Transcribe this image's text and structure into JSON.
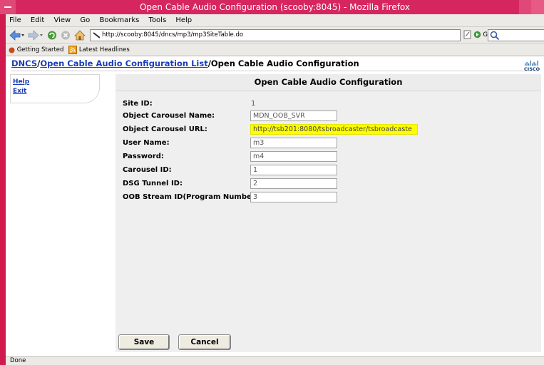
{
  "window": {
    "title": "Open Cable Audio Configuration (scooby:8045) - Mozilla Firefox"
  },
  "menu": {
    "items": [
      "File",
      "Edit",
      "View",
      "Go",
      "Bookmarks",
      "Tools",
      "Help"
    ]
  },
  "toolbar": {
    "url": "http://scooby:8045/dncs/mp3/mp3SiteTable.do",
    "go_label": "Go"
  },
  "bookmarks": {
    "items": [
      "Getting Started",
      "Latest Headlines"
    ]
  },
  "breadcrumb": {
    "crumb1": "DNCS",
    "sep1": "/",
    "crumb2": "Open Cable Audio Configuration List",
    "sep2": "/",
    "current": "Open Cable Audio Configuration"
  },
  "sidebar": {
    "items": [
      "Help",
      "Exit"
    ]
  },
  "form": {
    "heading": "Open Cable Audio Configuration",
    "fields": [
      {
        "label": "Site ID:",
        "value": "1"
      },
      {
        "label": "Object Carousel Name:",
        "value": "MDN_OOB_SVR"
      },
      {
        "label": "Object Carousel URL:",
        "value": "http://tsb201:8080/tsbroadcaster/tsbroadcaste"
      },
      {
        "label": "User Name:",
        "value": "m3"
      },
      {
        "label": "Password:",
        "value": "m4"
      },
      {
        "label": "Carousel ID:",
        "value": "1"
      },
      {
        "label": "DSG Tunnel ID:",
        "value": "2"
      },
      {
        "label": "OOB Stream ID(Program Number):",
        "value": "3"
      }
    ],
    "save_label": "Save",
    "cancel_label": "Cancel"
  },
  "status": {
    "text": "Done"
  },
  "colors": {
    "titlebar": "#d62660",
    "link": "#1a3db7",
    "highlight": "#ffff00"
  }
}
